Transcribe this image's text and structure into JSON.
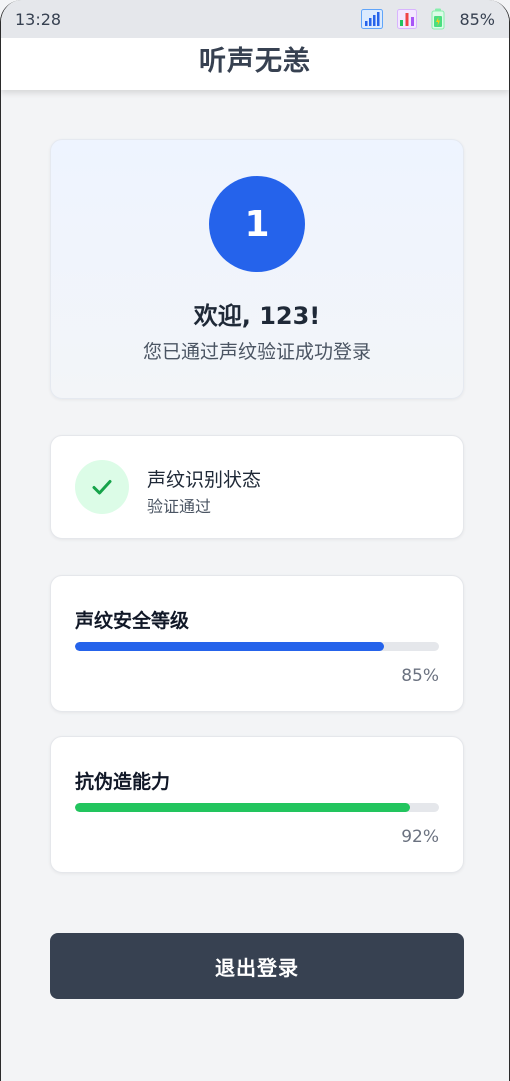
{
  "status_bar": {
    "time": "13:28",
    "battery_percent": "85%",
    "icons": [
      "wifi-signal-icon",
      "cellular-signal-icon",
      "battery-icon"
    ]
  },
  "header": {
    "title": "听声无恙"
  },
  "welcome": {
    "avatar_text": "1",
    "title": "欢迎, 123!",
    "subtitle": "您已通过声纹验证成功登录"
  },
  "recognition": {
    "title": "声纹识别状态",
    "status": "验证通过",
    "icon": "check-icon"
  },
  "metrics": [
    {
      "title": "声纹安全等级",
      "value_label": "85%",
      "value": 0.85,
      "color": "#2563eb"
    },
    {
      "title": "抗伪造能力",
      "value_label": "92%",
      "value": 0.92,
      "color": "#22c55e"
    }
  ],
  "actions": {
    "logout_label": "退出登录"
  },
  "colors": {
    "accent": "#2563eb",
    "success": "#22c55e",
    "button": "#374151"
  }
}
